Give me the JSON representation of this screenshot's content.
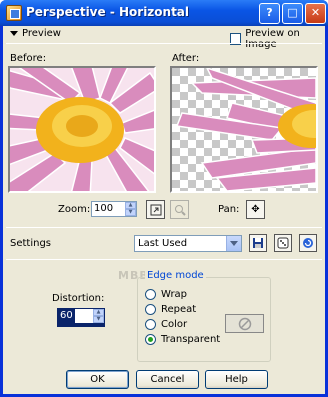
{
  "window": {
    "title": "Perspective - Horizontal"
  },
  "preview": {
    "toggle_label": "Preview",
    "preview_on_image_label": "Preview on Image",
    "before_label": "Before:",
    "after_label": "After:"
  },
  "zoom": {
    "label": "Zoom:",
    "value": "100"
  },
  "pan": {
    "label": "Pan:"
  },
  "settings": {
    "label": "Settings",
    "preset_value": "Last Used"
  },
  "distortion": {
    "label": "Distortion:",
    "value": "60"
  },
  "edge_mode": {
    "title": "Edge mode",
    "options": [
      "Wrap",
      "Repeat",
      "Color",
      "Transparent"
    ],
    "selected": "Transparent"
  },
  "watermark": "MBBMA",
  "buttons": {
    "ok": "OK",
    "cancel": "Cancel",
    "help": "Help"
  },
  "colors": {
    "title_bar": "#0a55e5",
    "dialog_bg": "#ece9d8",
    "accent_blue": "#0046d5",
    "petal_pink": "#d98cbd",
    "daisy_center": "#f2b21c"
  }
}
